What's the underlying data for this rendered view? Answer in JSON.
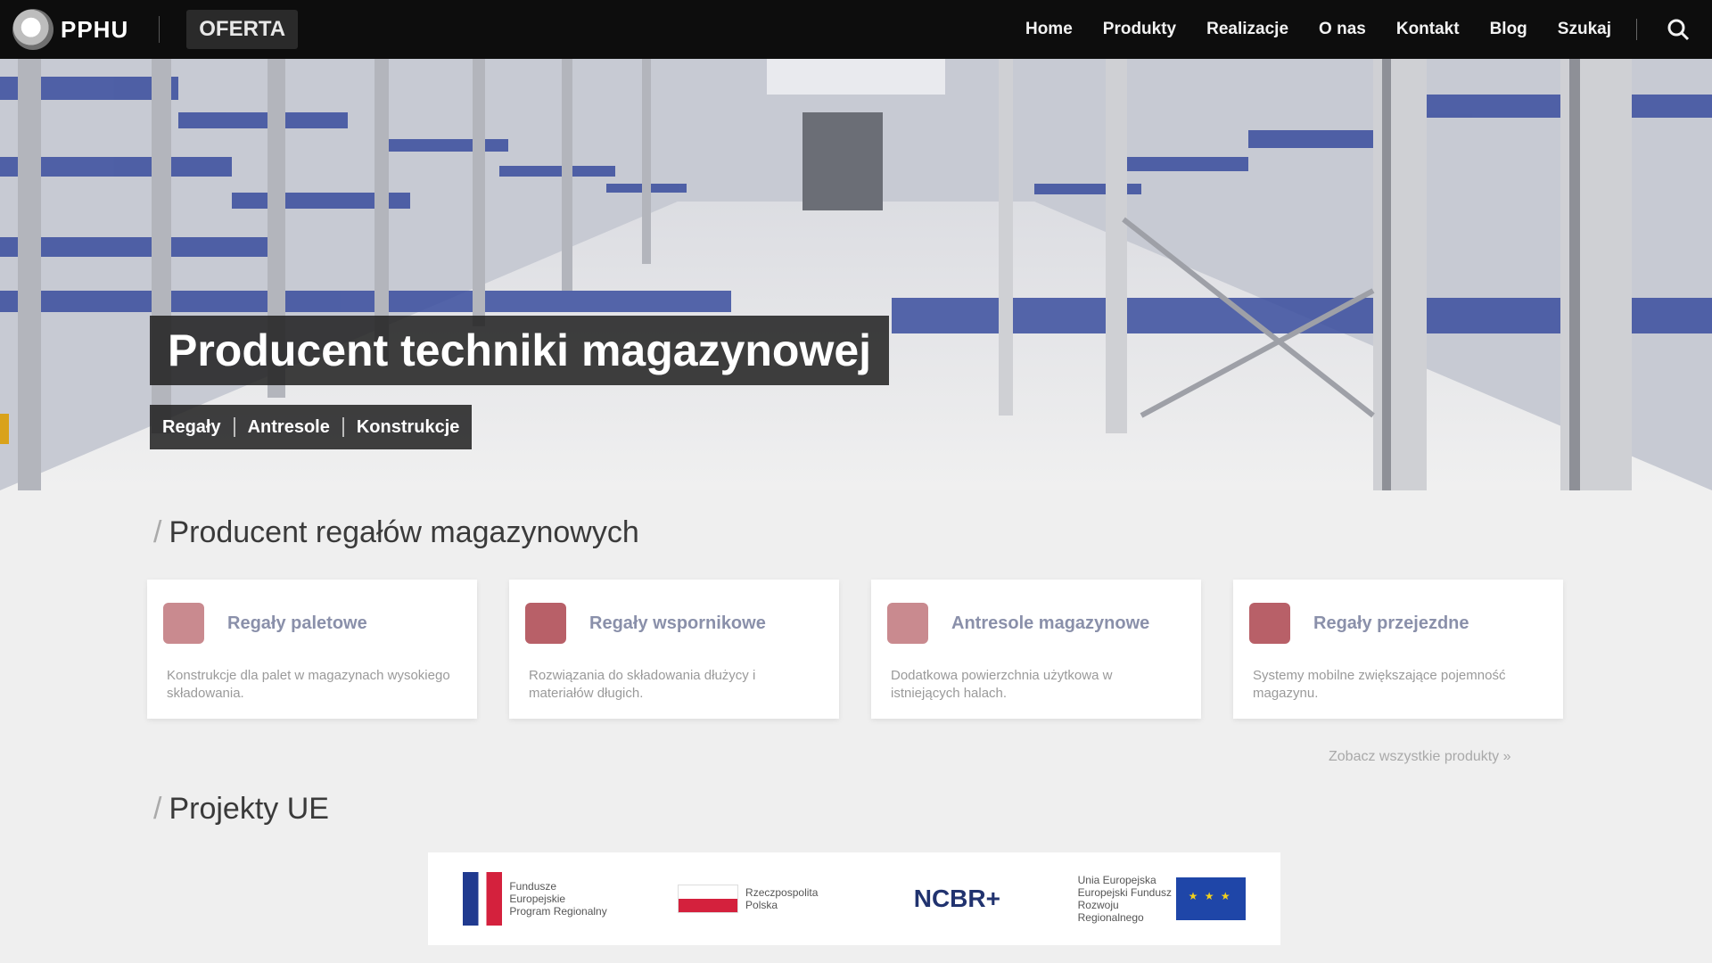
{
  "header": {
    "logo_text": "PPHU",
    "brand_sub": "OFERTA",
    "nav": [
      "Home",
      "Produkty",
      "Realizacje",
      "O nas",
      "Kontakt",
      "Blog",
      "Szukaj"
    ],
    "search_icon": "search-icon"
  },
  "hero": {
    "title": "Producent techniki magazynowej",
    "subtitle": "",
    "tags": [
      "Regały",
      "Antresole",
      "Konstrukcje"
    ],
    "accent_color": "#d9a21a"
  },
  "products_section": {
    "title": "Producent regałów magazynowych",
    "cards": [
      {
        "title": "Regały paletowe",
        "desc": "Konstrukcje dla palet w magazynach wysokiego składowania.",
        "icon": "pallet-rack-icon"
      },
      {
        "title": "Regały wspornikowe",
        "desc": "Rozwiązania do składowania dłużycy i materiałów długich.",
        "icon": "cantilever-rack-icon"
      },
      {
        "title": "Antresole magazynowe",
        "desc": "Dodatkowa powierzchnia użytkowa w istniejących halach.",
        "icon": "mezzanine-icon"
      },
      {
        "title": "Regały przejezdne",
        "desc": "Systemy mobilne zwiększające pojemność magazynu.",
        "icon": "mobile-rack-icon"
      }
    ],
    "more_link": "Zobacz wszystkie produkty »"
  },
  "eu_section": {
    "title": "Projekty UE",
    "logos": [
      {
        "name": "Fundusze Europejskie",
        "caption": "Fundusze Europejskie Program Regionalny"
      },
      {
        "name": "Rzeczpospolita Polska",
        "caption": "Rzeczpospolita Polska"
      },
      {
        "name": "NCBR",
        "caption": "NCBR+"
      },
      {
        "name": "Unia Europejska",
        "caption": "Unia Europejska Europejski Fundusz Rozwoju Regionalnego"
      }
    ]
  }
}
